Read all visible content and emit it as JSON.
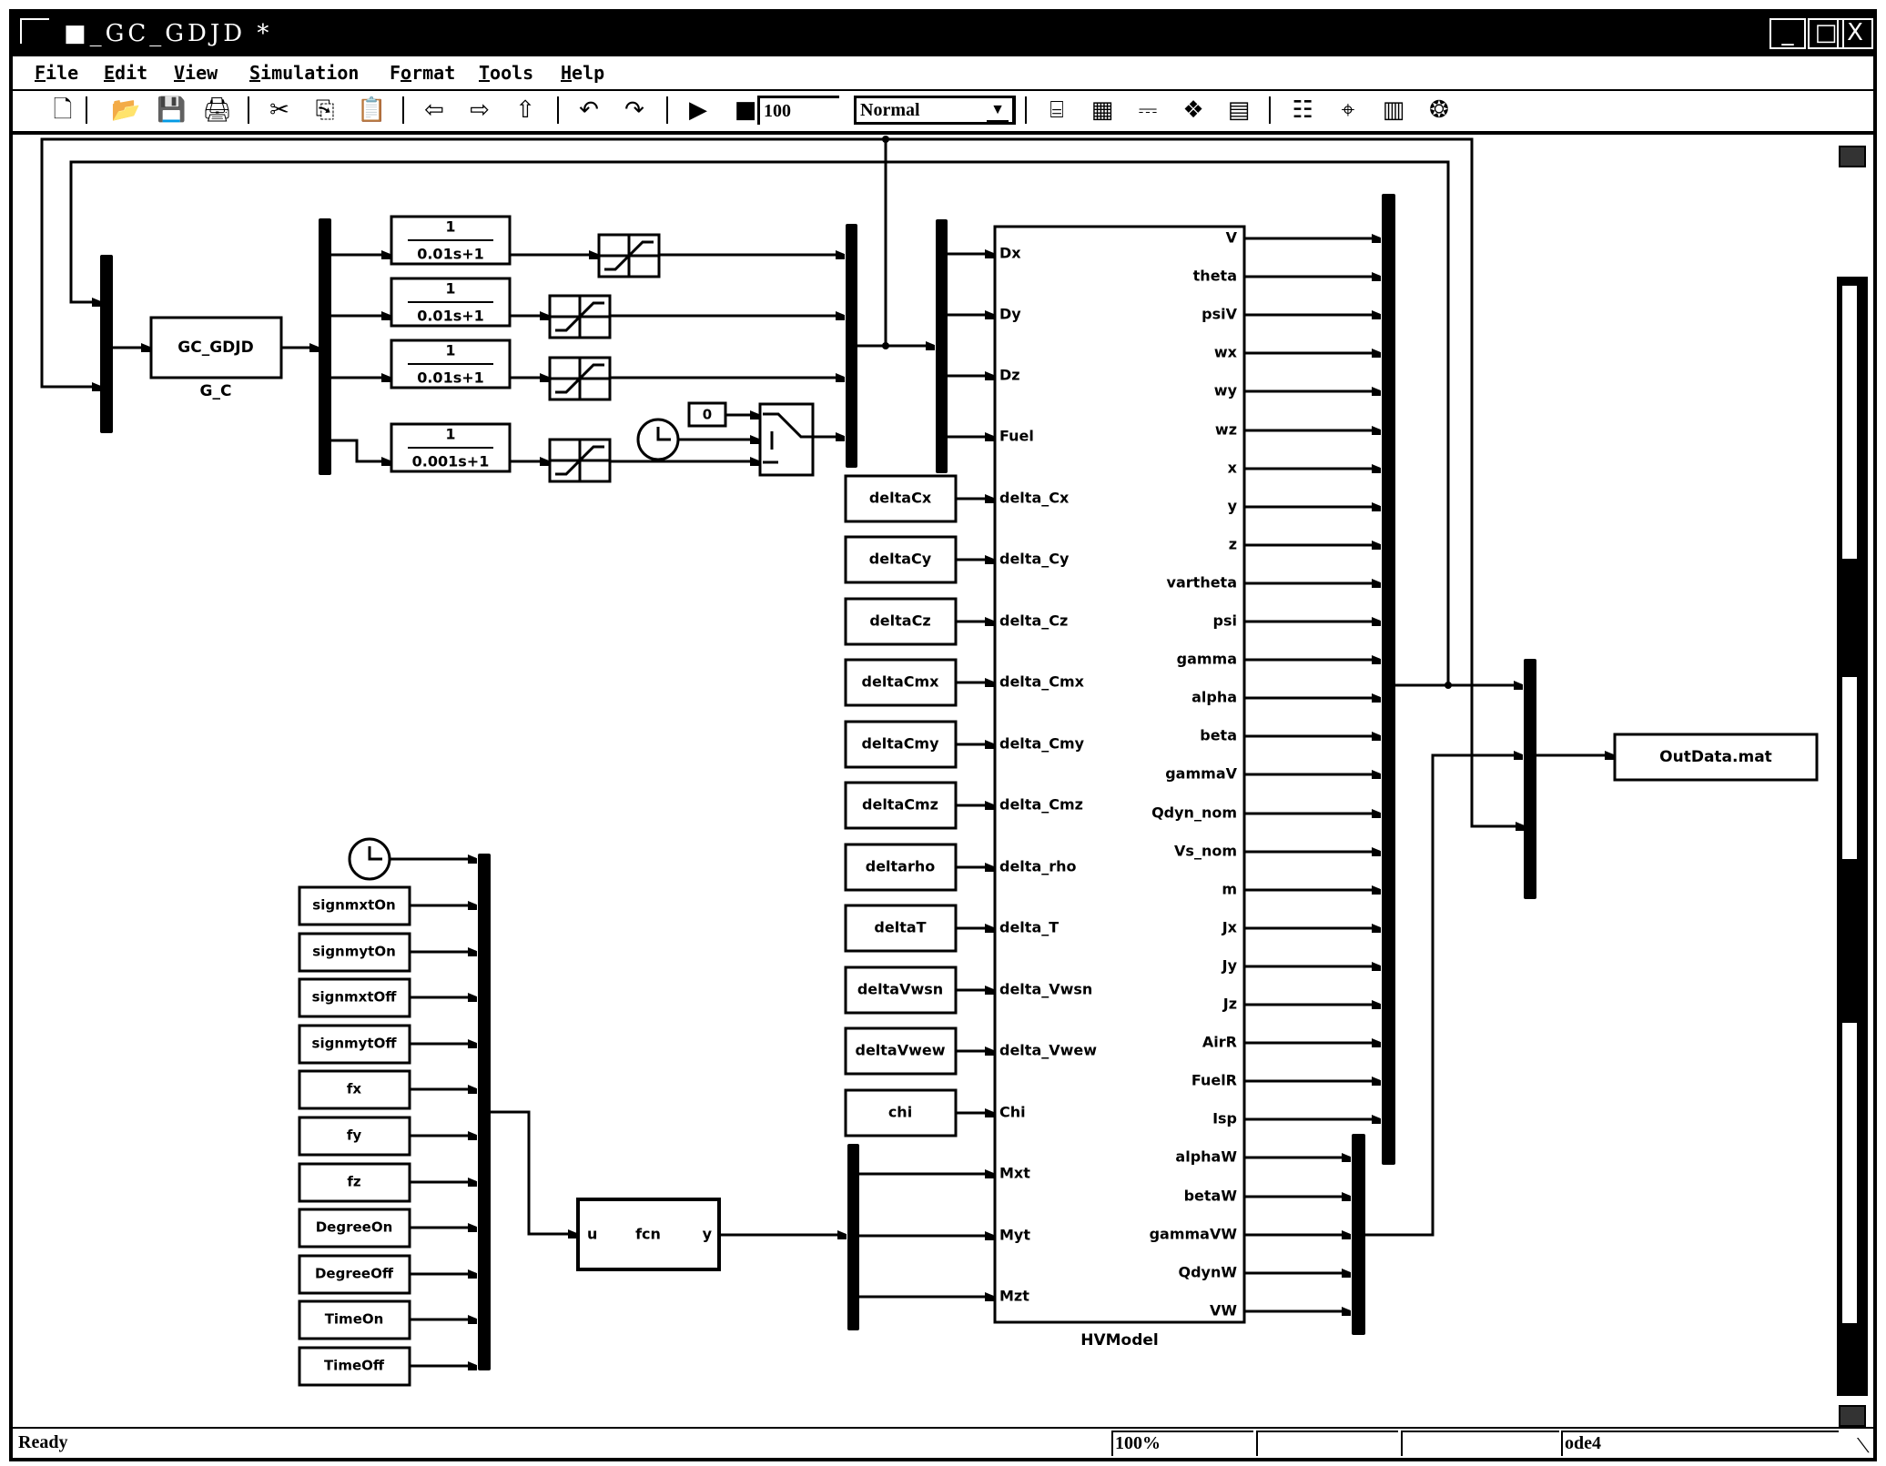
{
  "window": {
    "title": "■_GC_GDJD *",
    "minimize_label": "_",
    "maximize_label": "□",
    "close_label": "X"
  },
  "menu": [
    {
      "label": "File",
      "mnemonic": "F"
    },
    {
      "label": "Edit",
      "mnemonic": "E"
    },
    {
      "label": "View",
      "mnemonic": "V"
    },
    {
      "label": "Simulation",
      "mnemonic": "S"
    },
    {
      "label": "Format",
      "mnemonic": "o"
    },
    {
      "label": "Tools",
      "mnemonic": "T"
    },
    {
      "label": "Help",
      "mnemonic": "H"
    }
  ],
  "toolbar": {
    "icons": [
      {
        "name": "new-model-icon",
        "glyph": "🗋"
      },
      {
        "name": "open-icon",
        "glyph": "📂"
      },
      {
        "name": "save-icon",
        "glyph": "💾"
      },
      {
        "name": "print-icon",
        "glyph": "🖨"
      },
      {
        "name": "cut-icon",
        "glyph": "✂"
      },
      {
        "name": "copy-icon",
        "glyph": "⎘"
      },
      {
        "name": "paste-icon",
        "glyph": "📋"
      },
      {
        "name": "back-icon",
        "glyph": "⇦"
      },
      {
        "name": "forward-icon",
        "glyph": "⇨"
      },
      {
        "name": "up-icon",
        "glyph": "⇧"
      },
      {
        "name": "undo-icon",
        "glyph": "↶"
      },
      {
        "name": "redo-icon",
        "glyph": "↷"
      },
      {
        "name": "start-simulation-icon",
        "glyph": "▶"
      },
      {
        "name": "stop-simulation-icon",
        "glyph": "■"
      }
    ],
    "stop_time": "100",
    "sim_mode": "Normal",
    "right_icons": [
      {
        "name": "build-icon",
        "glyph": "⌸"
      },
      {
        "name": "update-diagram-icon",
        "glyph": "▦"
      },
      {
        "name": "build-subsystem-icon",
        "glyph": "⎓"
      },
      {
        "name": "library-browser-icon",
        "glyph": "❖"
      },
      {
        "name": "model-explorer-icon",
        "glyph": "▤"
      },
      {
        "name": "debug-icon",
        "glyph": "☷"
      },
      {
        "name": "zoom-icon",
        "glyph": "⌖"
      },
      {
        "name": "model-browser-icon",
        "glyph": "▥"
      },
      {
        "name": "config-icon",
        "glyph": "❂"
      }
    ]
  },
  "diagram": {
    "gc_block": {
      "label": "GC_GDJD",
      "name": "G_C"
    },
    "transfer_fcns": [
      {
        "num": "1",
        "den": "0.01s+1"
      },
      {
        "num": "1",
        "den": "0.01s+1"
      },
      {
        "num": "1",
        "den": "0.01s+1"
      },
      {
        "num": "1",
        "den": "0.001s+1"
      }
    ],
    "constant_block": "0",
    "hv_model": {
      "name": "HVModel",
      "inputs": [
        "Dx",
        "Dy",
        "Dz",
        "Fuel",
        "delta_Cx",
        "delta_Cy",
        "delta_Cz",
        "delta_Cmx",
        "delta_Cmy",
        "delta_Cmz",
        "delta_rho",
        "delta_T",
        "delta_Vwsn",
        "delta_Vwew",
        "Chi",
        "Mxt",
        "Myt",
        "Mzt"
      ],
      "outputs": [
        "V",
        "theta",
        "psiV",
        "wx",
        "wy",
        "wz",
        "x",
        "y",
        "z",
        "vartheta",
        "psi",
        "gamma",
        "alpha",
        "beta",
        "gammaV",
        "Qdyn_nom",
        "Vs_nom",
        "m",
        "Jx",
        "Jy",
        "Jz",
        "AirR",
        "FuelR",
        "Isp",
        "alphaW",
        "betaW",
        "gammaVW",
        "QdynW",
        "VW"
      ]
    },
    "delta_constants": [
      "deltaCx",
      "deltaCy",
      "deltaCz",
      "deltaCmx",
      "deltaCmy",
      "deltaCmz",
      "deltarho",
      "deltaT",
      "deltaVwsn",
      "deltaVwew",
      "chi"
    ],
    "signal_constants": [
      "signmxtOn",
      "signmytOn",
      "signmxtOff",
      "signmytOff",
      "fx",
      "fy",
      "fz",
      "DegreeOn",
      "DegreeOff",
      "TimeOn",
      "TimeOff"
    ],
    "fcn_block": {
      "in": "u",
      "label": "fcn",
      "out": "y"
    },
    "to_file": "OutData.mat"
  },
  "status": {
    "message": "Ready",
    "zoom": "100%",
    "cell2": "",
    "cell3": "",
    "solver": "ode4"
  }
}
